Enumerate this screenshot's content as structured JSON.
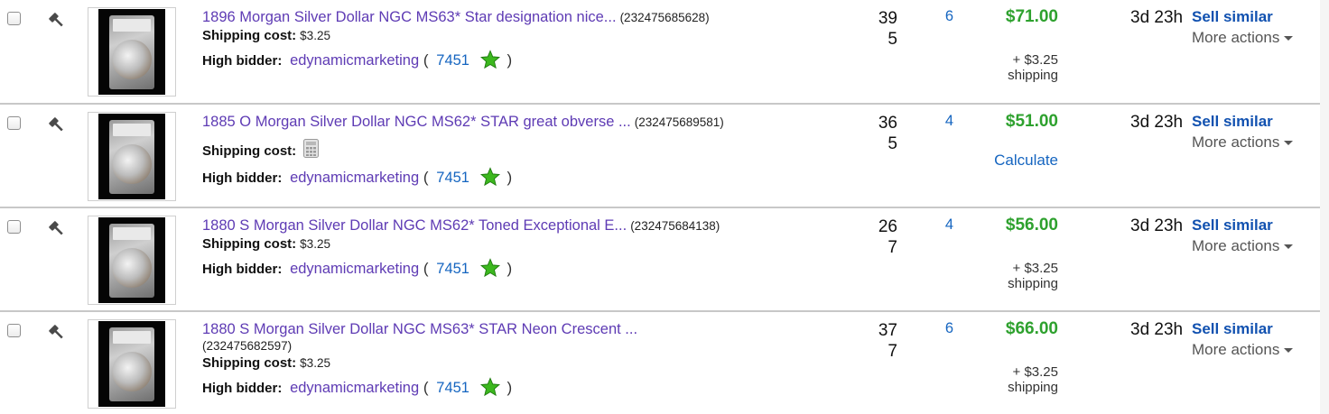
{
  "rows": [
    {
      "title": "1896 Morgan Silver Dollar NGC MS63* Star designation nice...",
      "item_id": "(232475685628)",
      "shipping_label": "Shipping cost:",
      "shipping_value": "$3.25",
      "bidder_label": "High bidder:",
      "bidder_name": "edynamicmarketing",
      "paren_open": "(",
      "feedback": "7451",
      "paren_close": ")",
      "watchers_line1": "39",
      "watchers_line2": "5",
      "bids": "6",
      "price": "$71.00",
      "shipping_add_line1": "+ $3.25",
      "shipping_add_line2": "shipping",
      "time_left": "3d 23h",
      "sell_similar": "Sell similar",
      "more_actions": "More actions"
    },
    {
      "title": "1885 O Morgan Silver Dollar NGC MS62* STAR great obverse ...",
      "item_id": "(232475689581)",
      "shipping_label": "Shipping cost:",
      "bidder_label": "High bidder:",
      "bidder_name": "edynamicmarketing",
      "paren_open": "(",
      "feedback": "7451",
      "paren_close": ")",
      "watchers_line1": "36",
      "watchers_line2": "5",
      "bids": "4",
      "price": "$51.00",
      "calculate": "Calculate",
      "time_left": "3d 23h",
      "sell_similar": "Sell similar",
      "more_actions": "More actions"
    },
    {
      "title": "1880 S Morgan Silver Dollar NGC MS62* Toned Exceptional E...",
      "item_id": "(232475684138)",
      "shipping_label": "Shipping cost:",
      "shipping_value": "$3.25",
      "bidder_label": "High bidder:",
      "bidder_name": "edynamicmarketing",
      "paren_open": "(",
      "feedback": "7451",
      "paren_close": ")",
      "watchers_line1": "26",
      "watchers_line2": "7",
      "bids": "4",
      "price": "$56.00",
      "shipping_add_line1": "+ $3.25",
      "shipping_add_line2": "shipping",
      "time_left": "3d 23h",
      "sell_similar": "Sell similar",
      "more_actions": "More actions"
    },
    {
      "title": "1880 S Morgan Silver Dollar NGC MS63* STAR Neon Crescent ...",
      "item_id": "(232475682597)",
      "shipping_label": "Shipping cost:",
      "shipping_value": "$3.25",
      "bidder_label": "High bidder:",
      "bidder_name": "edynamicmarketing",
      "paren_open": "(",
      "feedback": "7451",
      "paren_close": ")",
      "watchers_line1": "37",
      "watchers_line2": "7",
      "bids": "6",
      "price": "$66.00",
      "shipping_add_line1": "+ $3.25",
      "shipping_add_line2": "shipping",
      "time_left": "3d 23h",
      "sell_similar": "Sell similar",
      "more_actions": "More actions"
    }
  ],
  "icons": {
    "bid": "gavel-icon",
    "calculator": "calculator-icon",
    "rating": "green-star-icon",
    "dropdown": "caret-down-icon"
  },
  "colors": {
    "title_link": "#5e3bb4",
    "price": "#2ea12e",
    "link_blue": "#1565c0",
    "sell_similar": "#1151b0",
    "star": "#3cb81e"
  }
}
